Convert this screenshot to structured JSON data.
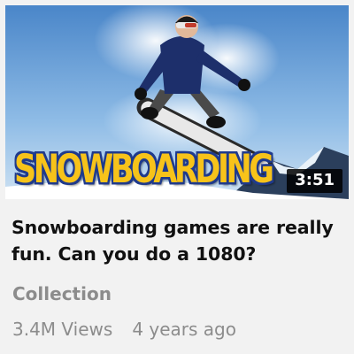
{
  "video": {
    "thumbnail": {
      "alt": "Snowboarder mid-air jump",
      "wordmark": "SNOWBOARDING",
      "wordmark_color": "#f7c31a",
      "wordmark_outline": "#1f3a8c"
    },
    "duration": "3:51",
    "title": "Snowboarding games are really fun. Can you do a 1080?",
    "channel": "Collection",
    "views": "3.4M Views",
    "age": "4 years ago"
  },
  "colors": {
    "background": "#f2f2f2",
    "title": "#111111",
    "secondary_text": "#8c8c8c",
    "duration_bg": "#000000"
  }
}
